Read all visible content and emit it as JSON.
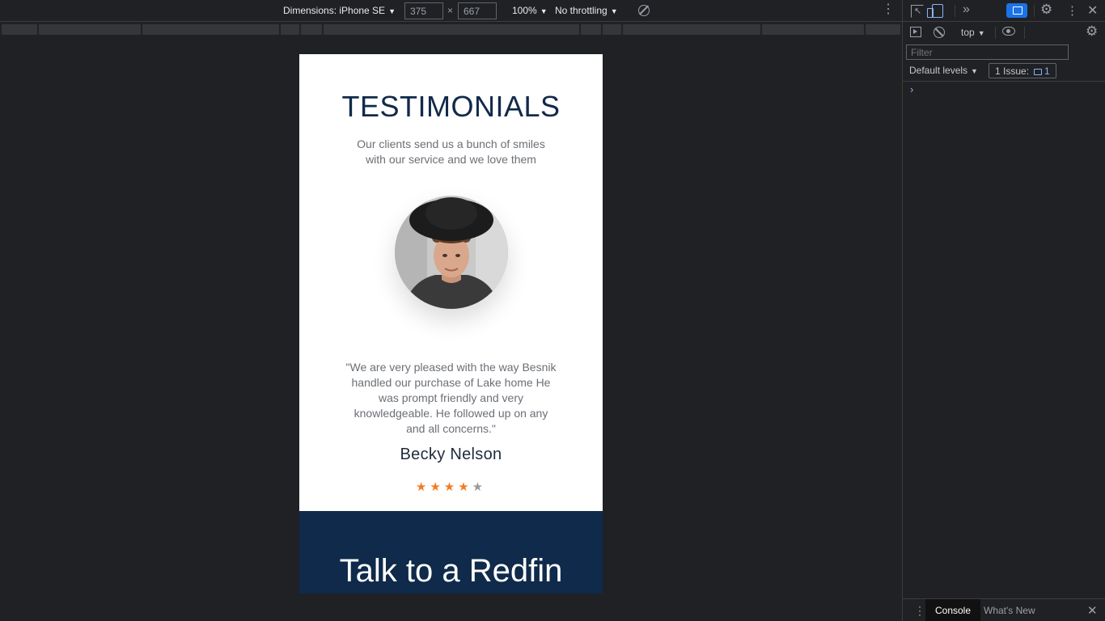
{
  "device_toolbar": {
    "dimensions_label": "Dimensions: iPhone SE",
    "width_value": "375",
    "height_value": "667",
    "times": "×",
    "zoom": "100%",
    "throttling": "No throttling",
    "dropdown_arrow": "▼"
  },
  "page": {
    "title": "TESTIMONIALS",
    "subtitle_line1": "Our clients send us a bunch of smiles",
    "subtitle_line2": "with our service and we love them",
    "quote": "\"We are very pleased with the way Besnik handled our purchase of Lake home He was prompt friendly and very knowledgeable. He followed up on any and all concerns.\"",
    "author": "Becky Nelson",
    "rating": 4,
    "rating_max": 5,
    "star_glyph": "★",
    "cta_title": "Talk to a Redfin",
    "colors": {
      "title": "#12294a",
      "star_on": "#f47b20",
      "star_off": "#9b9b9b",
      "cta_bg": "#0f2a4a"
    }
  },
  "devtools": {
    "context": "top",
    "filter_placeholder": "Filter",
    "levels": "Default levels",
    "issues_label": "1 Issue:",
    "issues_count": "1",
    "prompt": "›",
    "drawer_tabs": [
      "Console",
      "What's New"
    ],
    "icons": {
      "more_tabs": "»",
      "kebab": "⋮",
      "close": "✕",
      "gear": "⚙"
    }
  }
}
